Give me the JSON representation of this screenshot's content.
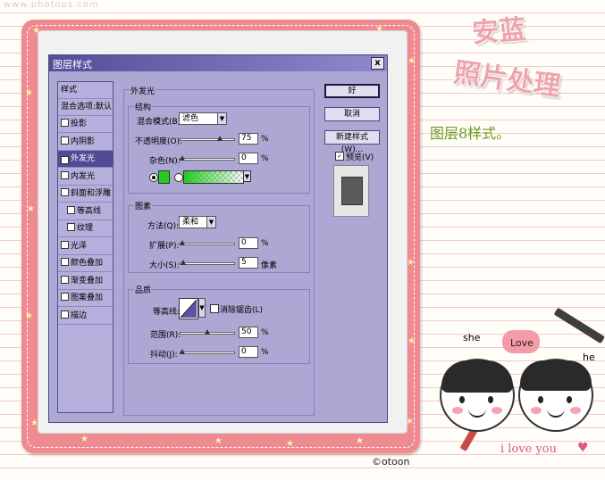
{
  "watermark": "www.photops.com",
  "deco_title_line1": "安蓝",
  "deco_title_line2": "照片处理",
  "caption": "图层8样式。",
  "copyright": "©otoon",
  "cartoon_labels": {
    "she": "she",
    "love": "Love",
    "he": "he",
    "footer": "i love you"
  },
  "dialog": {
    "title": "图层样式",
    "close": "x",
    "left_panel": {
      "header": "样式",
      "blend_item": "混合选项:默认",
      "items": [
        {
          "label": "投影",
          "checked": false,
          "selected": false,
          "indent": false
        },
        {
          "label": "内阴影",
          "checked": false,
          "selected": false,
          "indent": false
        },
        {
          "label": "外发光",
          "checked": true,
          "selected": true,
          "indent": false
        },
        {
          "label": "内发光",
          "checked": false,
          "selected": false,
          "indent": false
        },
        {
          "label": "斜面和浮雕",
          "checked": false,
          "selected": false,
          "indent": false
        },
        {
          "label": "等高线",
          "checked": false,
          "selected": false,
          "indent": true
        },
        {
          "label": "纹理",
          "checked": false,
          "selected": false,
          "indent": true
        },
        {
          "label": "光泽",
          "checked": false,
          "selected": false,
          "indent": false
        },
        {
          "label": "颜色叠加",
          "checked": false,
          "selected": false,
          "indent": false
        },
        {
          "label": "渐变叠加",
          "checked": false,
          "selected": false,
          "indent": false
        },
        {
          "label": "图案叠加",
          "checked": false,
          "selected": false,
          "indent": false
        },
        {
          "label": "描边",
          "checked": false,
          "selected": false,
          "indent": false
        }
      ]
    },
    "outer_glow": {
      "title": "外发光",
      "structure": {
        "title": "结构",
        "blend_mode_label": "混合模式(B):",
        "blend_mode_value": "滤色",
        "opacity_label": "不透明度(O):",
        "opacity_value": "75",
        "opacity_unit": "%",
        "opacity_level": 0.75,
        "noise_label": "杂色(N):",
        "noise_value": "0",
        "noise_unit": "%",
        "noise_level": 0,
        "glow_color": "#22cc22"
      },
      "elements": {
        "title": "图素",
        "method_label": "方法(Q):",
        "method_value": "柔和",
        "spread_label": "扩展(P):",
        "spread_value": "0",
        "spread_unit": "%",
        "spread_level": 0,
        "size_label": "大小(S):",
        "size_value": "5",
        "size_unit": "像素",
        "size_level": 0.02
      },
      "quality": {
        "title": "品质",
        "contour_label": "等高线:",
        "antialias_label": "消除锯齿(L)",
        "antialias_checked": false,
        "range_label": "范围(R):",
        "range_value": "50",
        "range_unit": "%",
        "range_level": 0.5,
        "jitter_label": "抖动(J):",
        "jitter_value": "0",
        "jitter_unit": "%",
        "jitter_level": 0
      }
    },
    "buttons": {
      "ok": "好",
      "cancel": "取消",
      "new_style": "新建样式(W)...",
      "preview_label": "预览(V)",
      "preview_checked": true
    }
  }
}
